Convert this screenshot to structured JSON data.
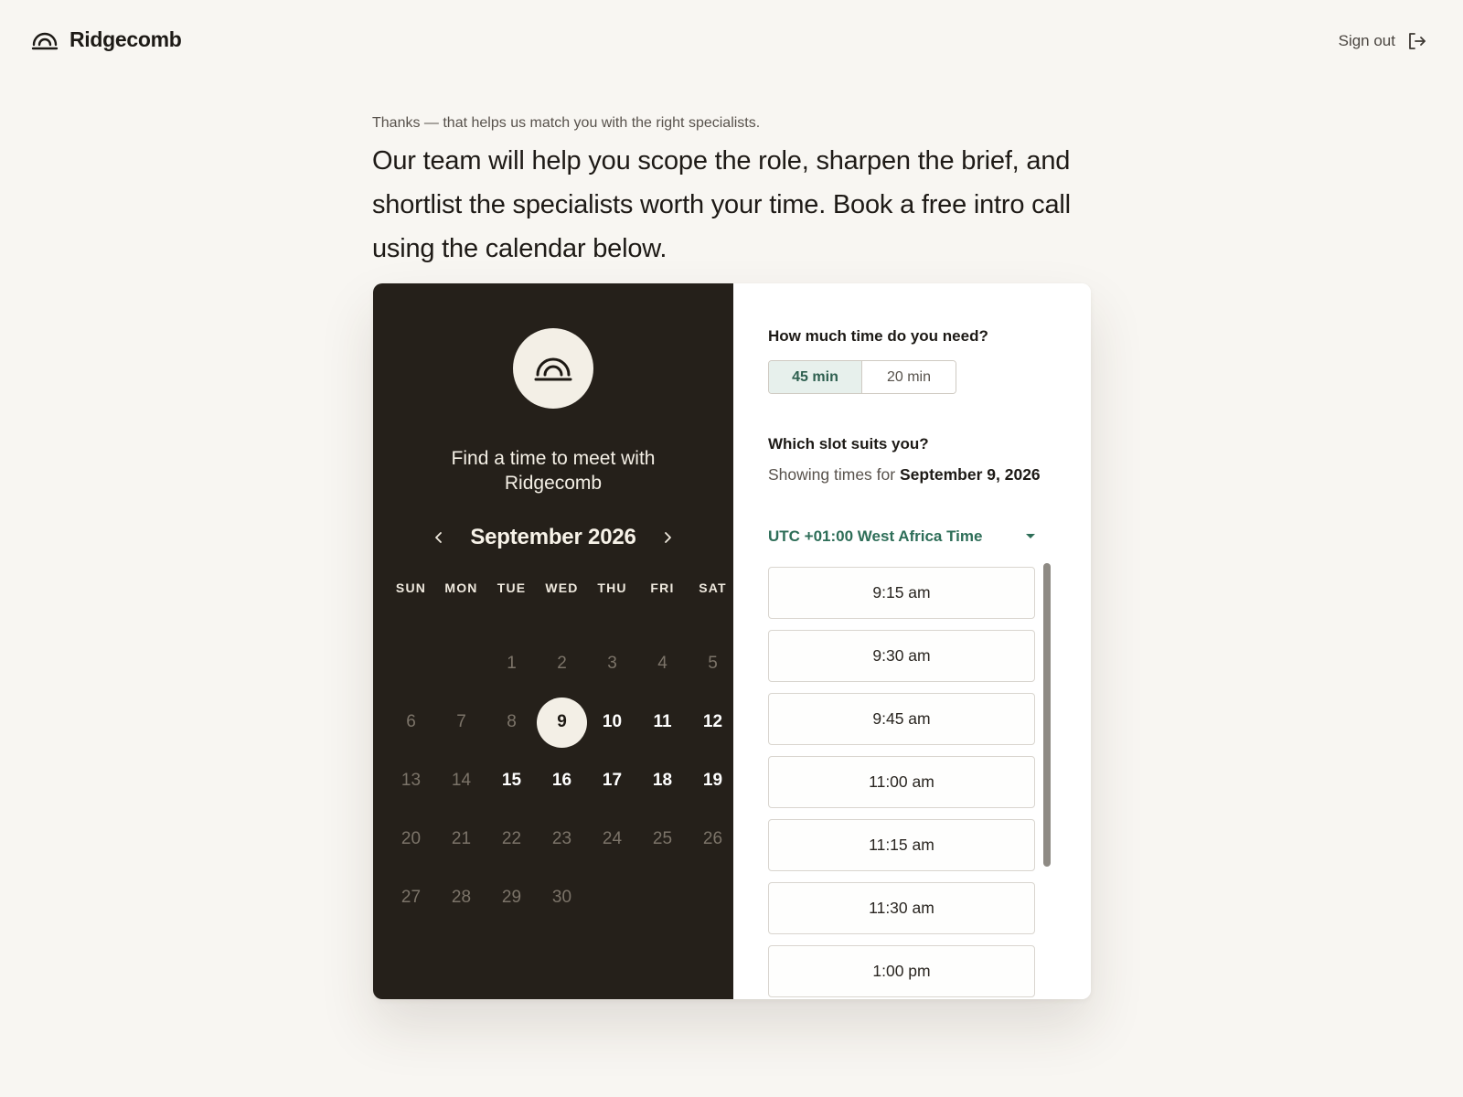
{
  "header": {
    "brand_name": "Ridgecomb",
    "signout_label": "Sign out"
  },
  "intro": {
    "subtitle": "Thanks — that helps us match you with the right specialists.",
    "lead": "Our team will help you scope the role, sharpen the brief, and shortlist the specialists worth your time. Book a free intro call using the calendar below."
  },
  "calendar": {
    "title": "Find a time to meet with Ridgecomb",
    "month_label": "September 2026",
    "weekdays": [
      "SUN",
      "MON",
      "TUE",
      "WED",
      "THU",
      "FRI",
      "SAT"
    ],
    "selected_day": "9",
    "weeks": [
      [
        null,
        null,
        "1",
        "2",
        "3",
        "4",
        "5"
      ],
      [
        "6",
        "7",
        "8",
        "9",
        "10",
        "11",
        "12"
      ],
      [
        "13",
        "14",
        "15",
        "16",
        "17",
        "18",
        "19"
      ],
      [
        "20",
        "21",
        "22",
        "23",
        "24",
        "25",
        "26"
      ],
      [
        "27",
        "28",
        "29",
        "30",
        null,
        null,
        null
      ]
    ],
    "available_days": [
      "9",
      "10",
      "11",
      "12",
      "15",
      "16",
      "17",
      "18",
      "19"
    ]
  },
  "booking": {
    "duration_question": "How much time do you need?",
    "durations": [
      {
        "label": "45 min",
        "selected": true
      },
      {
        "label": "20 min",
        "selected": false
      }
    ],
    "slot_question": "Which slot suits you?",
    "showing_prefix": "Showing times for",
    "showing_date": "September 9, 2026",
    "timezone": "UTC +01:00 West Africa Time",
    "slots": [
      "9:15 am",
      "9:30 am",
      "9:45 am",
      "11:00 am",
      "11:15 am",
      "11:30 am",
      "1:00 pm"
    ]
  },
  "colors": {
    "background": "#f8f6f2",
    "calendar_panel": "#25201a",
    "accent_green": "#2e6e58",
    "selected_duration_bg": "#e7f0ec"
  }
}
